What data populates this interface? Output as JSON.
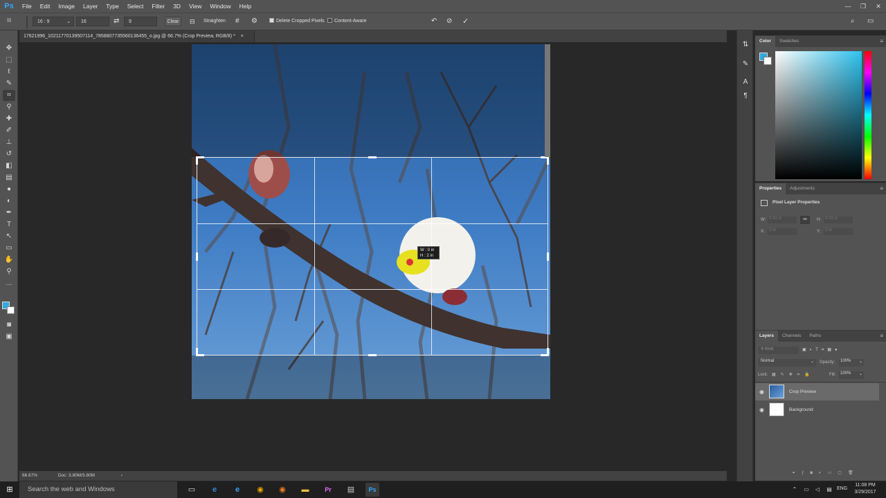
{
  "app": {
    "logo": "Ps"
  },
  "menu": [
    "File",
    "Edit",
    "Image",
    "Layer",
    "Type",
    "Select",
    "Filter",
    "3D",
    "View",
    "Window",
    "Help"
  ],
  "options": {
    "ratio": "16 : 9",
    "width_value": "16",
    "height_value": "9",
    "clear_label": "Clear",
    "straighten_label": "Straighten",
    "delete_cropped_label": "Delete Cropped Pixels",
    "delete_cropped_checked": true,
    "content_aware_label": "Content-Aware",
    "content_aware_checked": false
  },
  "document": {
    "tab_title": "17621996_10211770139507114_7858807735560136455_o.jpg @ 66.7% (Crop Preview, RGB/8) *",
    "close": "×"
  },
  "crop_tooltip": {
    "w": "W :   0 in",
    "h": "H :   2 in"
  },
  "status": {
    "zoom": "66.67%",
    "doc": "Doc: 3.80M/3.80M"
  },
  "panels": {
    "color": {
      "tabs": [
        "Color",
        "Swatches"
      ]
    },
    "properties": {
      "tabs": [
        "Properties",
        "Adjustments"
      ],
      "title": "Pixel Layer Properties",
      "w_label": "W:",
      "w_value": "0.41 in",
      "h_label": "H:",
      "h_value": "0.23 in",
      "x_label": "X:",
      "x_value": "0 in",
      "y_label": "Y:",
      "y_value": "0 in"
    },
    "layers": {
      "tabs": [
        "Layers",
        "Channels",
        "Paths"
      ],
      "kind_placeholder": "Kind",
      "blend_mode": "Normal",
      "opacity_label": "Opacity:",
      "opacity": "100%",
      "lock_label": "Lock:",
      "fill_label": "Fill:",
      "fill": "100%",
      "items": [
        {
          "name": "Crop Preview",
          "selected": true
        },
        {
          "name": "Background",
          "selected": false
        }
      ]
    }
  },
  "taskbar": {
    "search_placeholder": "Search the web and Windows",
    "time": "11:08 PM",
    "date": "3/29/2017",
    "lang": "ENG"
  },
  "colors": {
    "foreground": "#31a8e0",
    "accent": "#31a8ff"
  }
}
